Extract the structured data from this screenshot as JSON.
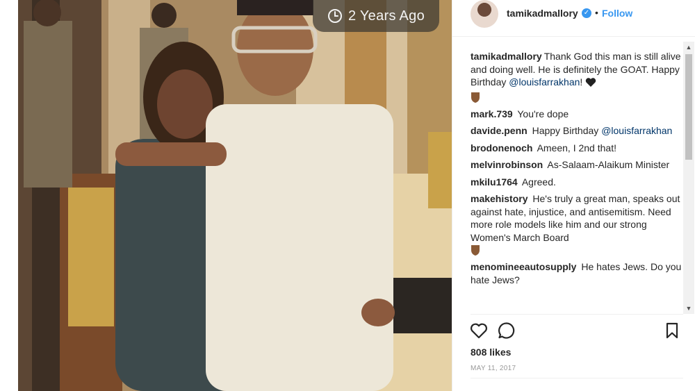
{
  "photo": {
    "time_badge": "2 Years Ago",
    "icon": "clock-icon"
  },
  "header": {
    "username": "tamikadmallory",
    "separator": "•",
    "follow_label": "Follow",
    "verified_icon": "verified-badge-icon"
  },
  "comments": [
    {
      "user": "tamikadmallory",
      "parts": [
        "Thank God this man is still alive and doing well. He is definitely the GOAT. Happy Birthday ",
        "@louisfarrakhan",
        "! "
      ]
    },
    {
      "user": "mark.739",
      "text": "You're dope"
    },
    {
      "user": "davide.penn",
      "parts": [
        "Happy Birthday ",
        "@louisfarrakhan"
      ]
    },
    {
      "user": "brodonenoch",
      "text": "Ameen, I 2nd that!"
    },
    {
      "user": "melvinrobinson",
      "text": "As-Salaam-Alaikum Minister"
    },
    {
      "user": "mkilu1764",
      "text": "Agreed."
    },
    {
      "user": "makehistory",
      "text": "He's truly a great man, speaks out against hate, injustice, and antisemitism. Need more role models like him and our strong Women's March Board"
    },
    {
      "user": "menomineeautosupply",
      "text": "He hates Jews. Do you hate Jews?"
    }
  ],
  "actions": {
    "like_icon": "heart-icon",
    "comment_icon": "comment-icon",
    "save_icon": "bookmark-icon"
  },
  "likes": "808 likes",
  "date": "MAY 11, 2017",
  "colors": {
    "link": "#3897f0",
    "mention": "#003569",
    "text": "#262626",
    "muted": "#999999"
  }
}
